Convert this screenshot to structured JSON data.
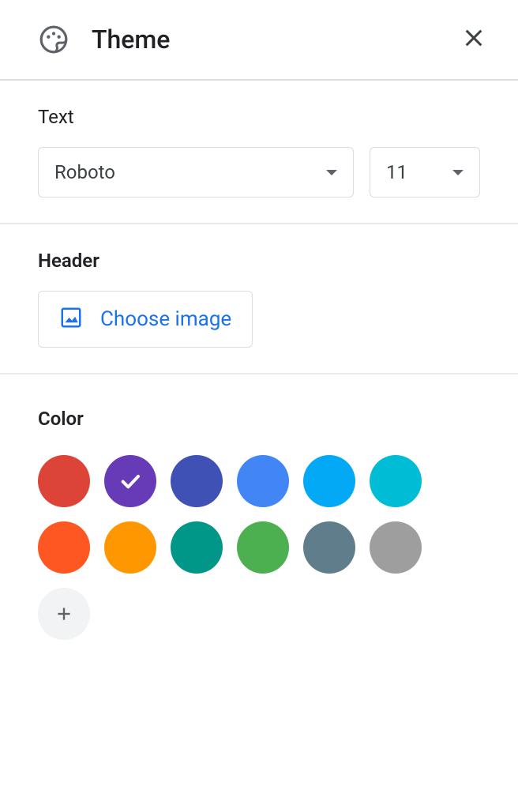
{
  "header": {
    "title": "Theme"
  },
  "sections": {
    "text": {
      "title": "Text",
      "font_value": "Roboto",
      "size_value": "11"
    },
    "headerImage": {
      "title": "Header",
      "choose_label": "Choose image"
    },
    "color": {
      "title": "Color",
      "swatches": [
        {
          "name": "red-orange",
          "hex": "#db4437",
          "selected": false
        },
        {
          "name": "purple",
          "hex": "#673ab7",
          "selected": true
        },
        {
          "name": "indigo",
          "hex": "#3f51b5",
          "selected": false
        },
        {
          "name": "blue",
          "hex": "#4285f4",
          "selected": false
        },
        {
          "name": "light-blue",
          "hex": "#03a9f4",
          "selected": false
        },
        {
          "name": "teal",
          "hex": "#00bcd4",
          "selected": false
        },
        {
          "name": "deep-orange",
          "hex": "#ff5722",
          "selected": false
        },
        {
          "name": "orange",
          "hex": "#ff9800",
          "selected": false
        },
        {
          "name": "green",
          "hex": "#009688",
          "selected": false
        },
        {
          "name": "light-green",
          "hex": "#4caf50",
          "selected": false
        },
        {
          "name": "blue-grey",
          "hex": "#607d8b",
          "selected": false
        },
        {
          "name": "grey",
          "hex": "#9e9e9e",
          "selected": false
        }
      ]
    }
  }
}
